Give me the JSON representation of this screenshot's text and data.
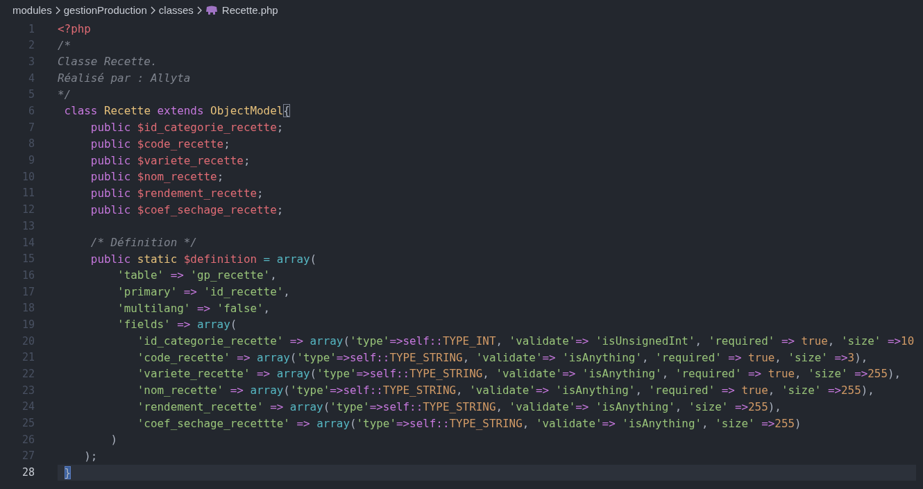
{
  "breadcrumb": [
    {
      "label": "modules",
      "kind": "folder"
    },
    {
      "label": "gestionProduction",
      "kind": "folder"
    },
    {
      "label": "classes",
      "kind": "folder"
    },
    {
      "label": "Recette.php",
      "kind": "php_file"
    }
  ],
  "lines": [
    {
      "number": "1",
      "current": false,
      "tokens": [
        {
          "text": "<?php",
          "kind": "tag"
        }
      ]
    },
    {
      "number": "2",
      "current": false,
      "tokens": [
        {
          "text": "/*",
          "kind": "comment"
        }
      ]
    },
    {
      "number": "3",
      "current": false,
      "tokens": [
        {
          "text": "Classe Recette.",
          "kind": "comment"
        }
      ]
    },
    {
      "number": "4",
      "current": false,
      "tokens": [
        {
          "text": "Réalisé par : Allyta",
          "kind": "comment"
        }
      ]
    },
    {
      "number": "5",
      "current": false,
      "tokens": [
        {
          "text": "*/",
          "kind": "comment"
        }
      ]
    },
    {
      "number": "6",
      "current": false,
      "tokens": [
        {
          "text": " class",
          "kind": "keyword"
        },
        {
          "text": " Recette",
          "kind": "class"
        },
        {
          "text": " extends",
          "kind": "keyword"
        },
        {
          "text": " ObjectModel",
          "kind": "class"
        },
        {
          "text": "{",
          "kind": "bracket_match"
        }
      ]
    },
    {
      "number": "7",
      "current": false,
      "tokens": [
        {
          "text": "     public",
          "kind": "keyword"
        },
        {
          "text": " $id_categorie_recette",
          "kind": "variable"
        },
        {
          "text": ";",
          "kind": "plain"
        }
      ]
    },
    {
      "number": "8",
      "current": false,
      "tokens": [
        {
          "text": "     public",
          "kind": "keyword"
        },
        {
          "text": " $code_recette",
          "kind": "variable"
        },
        {
          "text": ";",
          "kind": "plain"
        }
      ]
    },
    {
      "number": "9",
      "current": false,
      "tokens": [
        {
          "text": "     public",
          "kind": "keyword"
        },
        {
          "text": " $variete_recette",
          "kind": "variable"
        },
        {
          "text": ";",
          "kind": "plain"
        }
      ]
    },
    {
      "number": "10",
      "current": false,
      "tokens": [
        {
          "text": "     public",
          "kind": "keyword"
        },
        {
          "text": " $nom_recette",
          "kind": "variable"
        },
        {
          "text": ";",
          "kind": "plain"
        }
      ]
    },
    {
      "number": "11",
      "current": false,
      "tokens": [
        {
          "text": "     public",
          "kind": "keyword"
        },
        {
          "text": " $rendement_recette",
          "kind": "variable"
        },
        {
          "text": ";",
          "kind": "plain"
        }
      ]
    },
    {
      "number": "12",
      "current": false,
      "tokens": [
        {
          "text": "     public",
          "kind": "keyword"
        },
        {
          "text": " $coef_sechage_recette",
          "kind": "variable"
        },
        {
          "text": ";",
          "kind": "plain"
        }
      ]
    },
    {
      "number": "13",
      "current": false
    },
    {
      "number": "14",
      "current": false,
      "tokens": [
        {
          "text": "     /* Définition */",
          "kind": "comment"
        }
      ]
    },
    {
      "number": "15",
      "current": false,
      "tokens": [
        {
          "text": "     public",
          "kind": "keyword"
        },
        {
          "text": " static",
          "kind": "class"
        },
        {
          "text": " $definition",
          "kind": "variable"
        },
        {
          "text": " =",
          "kind": "function"
        },
        {
          "text": " array",
          "kind": "function"
        },
        {
          "text": "(",
          "kind": "plain"
        }
      ]
    },
    {
      "number": "16",
      "current": false,
      "tokens": [
        {
          "text": "         'table'",
          "kind": "string"
        },
        {
          "text": " =>",
          "kind": "operator"
        },
        {
          "text": " 'gp_recette'",
          "kind": "string"
        },
        {
          "text": ",",
          "kind": "plain"
        }
      ]
    },
    {
      "number": "17",
      "current": false,
      "tokens": [
        {
          "text": "         'primary'",
          "kind": "string"
        },
        {
          "text": " =>",
          "kind": "operator"
        },
        {
          "text": " 'id_recette'",
          "kind": "string"
        },
        {
          "text": ",",
          "kind": "plain"
        }
      ]
    },
    {
      "number": "18",
      "current": false,
      "tokens": [
        {
          "text": "         'multilang'",
          "kind": "string"
        },
        {
          "text": " =>",
          "kind": "operator"
        },
        {
          "text": " 'false'",
          "kind": "string"
        },
        {
          "text": ",",
          "kind": "plain"
        }
      ]
    },
    {
      "number": "19",
      "current": false,
      "tokens": [
        {
          "text": "         'fields'",
          "kind": "string"
        },
        {
          "text": " =>",
          "kind": "operator"
        },
        {
          "text": " array",
          "kind": "function"
        },
        {
          "text": "(",
          "kind": "plain"
        }
      ]
    },
    {
      "number": "20",
      "current": false,
      "tokens": [
        {
          "text": "            'id_categorie_recette'",
          "kind": "string"
        },
        {
          "text": " =>",
          "kind": "operator"
        },
        {
          "text": " array",
          "kind": "function"
        },
        {
          "text": "(",
          "kind": "plain"
        },
        {
          "text": "'type'",
          "kind": "string"
        },
        {
          "text": "=>",
          "kind": "operator"
        },
        {
          "text": "self::",
          "kind": "keyword"
        },
        {
          "text": "TYPE_INT",
          "kind": "constant"
        },
        {
          "text": ", ",
          "kind": "plain"
        },
        {
          "text": "'validate'",
          "kind": "string"
        },
        {
          "text": "=>",
          "kind": "operator"
        },
        {
          "text": " 'isUnsignedInt'",
          "kind": "string"
        },
        {
          "text": ", ",
          "kind": "plain"
        },
        {
          "text": "'required'",
          "kind": "string"
        },
        {
          "text": " =>",
          "kind": "operator"
        },
        {
          "text": " true",
          "kind": "constant"
        },
        {
          "text": ", ",
          "kind": "plain"
        },
        {
          "text": "'size'",
          "kind": "string"
        },
        {
          "text": " =>",
          "kind": "operator"
        },
        {
          "text": "10",
          "kind": "constant"
        }
      ]
    },
    {
      "number": "21",
      "current": false,
      "tokens": [
        {
          "text": "            'code_recette'",
          "kind": "string"
        },
        {
          "text": " =>",
          "kind": "operator"
        },
        {
          "text": " array",
          "kind": "function"
        },
        {
          "text": "(",
          "kind": "plain"
        },
        {
          "text": "'type'",
          "kind": "string"
        },
        {
          "text": "=>",
          "kind": "operator"
        },
        {
          "text": "self::",
          "kind": "keyword"
        },
        {
          "text": "TYPE_STRING",
          "kind": "constant"
        },
        {
          "text": ", ",
          "kind": "plain"
        },
        {
          "text": "'validate'",
          "kind": "string"
        },
        {
          "text": "=>",
          "kind": "operator"
        },
        {
          "text": " 'isAnything'",
          "kind": "string"
        },
        {
          "text": ", ",
          "kind": "plain"
        },
        {
          "text": "'required'",
          "kind": "string"
        },
        {
          "text": " =>",
          "kind": "operator"
        },
        {
          "text": " true",
          "kind": "constant"
        },
        {
          "text": ", ",
          "kind": "plain"
        },
        {
          "text": "'size'",
          "kind": "string"
        },
        {
          "text": " =>",
          "kind": "operator"
        },
        {
          "text": "3",
          "kind": "constant"
        },
        {
          "text": "),",
          "kind": "plain"
        }
      ]
    },
    {
      "number": "22",
      "current": false,
      "tokens": [
        {
          "text": "            'variete_recette'",
          "kind": "string"
        },
        {
          "text": " =>",
          "kind": "operator"
        },
        {
          "text": " array",
          "kind": "function"
        },
        {
          "text": "(",
          "kind": "plain"
        },
        {
          "text": "'type'",
          "kind": "string"
        },
        {
          "text": "=>",
          "kind": "operator"
        },
        {
          "text": "self::",
          "kind": "keyword"
        },
        {
          "text": "TYPE_STRING",
          "kind": "constant"
        },
        {
          "text": ", ",
          "kind": "plain"
        },
        {
          "text": "'validate'",
          "kind": "string"
        },
        {
          "text": "=>",
          "kind": "operator"
        },
        {
          "text": " 'isAnything'",
          "kind": "string"
        },
        {
          "text": ", ",
          "kind": "plain"
        },
        {
          "text": "'required'",
          "kind": "string"
        },
        {
          "text": " =>",
          "kind": "operator"
        },
        {
          "text": " true",
          "kind": "constant"
        },
        {
          "text": ", ",
          "kind": "plain"
        },
        {
          "text": "'size'",
          "kind": "string"
        },
        {
          "text": " =>",
          "kind": "operator"
        },
        {
          "text": "255",
          "kind": "constant"
        },
        {
          "text": "),",
          "kind": "plain"
        }
      ]
    },
    {
      "number": "23",
      "current": false,
      "tokens": [
        {
          "text": "            'nom_recette'",
          "kind": "string"
        },
        {
          "text": " =>",
          "kind": "operator"
        },
        {
          "text": " array",
          "kind": "function"
        },
        {
          "text": "(",
          "kind": "plain"
        },
        {
          "text": "'type'",
          "kind": "string"
        },
        {
          "text": "=>",
          "kind": "operator"
        },
        {
          "text": "self::",
          "kind": "keyword"
        },
        {
          "text": "TYPE_STRING",
          "kind": "constant"
        },
        {
          "text": ", ",
          "kind": "plain"
        },
        {
          "text": "'validate'",
          "kind": "string"
        },
        {
          "text": "=>",
          "kind": "operator"
        },
        {
          "text": " 'isAnything'",
          "kind": "string"
        },
        {
          "text": ", ",
          "kind": "plain"
        },
        {
          "text": "'required'",
          "kind": "string"
        },
        {
          "text": " =>",
          "kind": "operator"
        },
        {
          "text": " true",
          "kind": "constant"
        },
        {
          "text": ", ",
          "kind": "plain"
        },
        {
          "text": "'size'",
          "kind": "string"
        },
        {
          "text": " =>",
          "kind": "operator"
        },
        {
          "text": "255",
          "kind": "constant"
        },
        {
          "text": "),",
          "kind": "plain"
        }
      ]
    },
    {
      "number": "24",
      "current": false,
      "tokens": [
        {
          "text": "            'rendement_recette'",
          "kind": "string"
        },
        {
          "text": " =>",
          "kind": "operator"
        },
        {
          "text": " array",
          "kind": "function"
        },
        {
          "text": "(",
          "kind": "plain"
        },
        {
          "text": "'type'",
          "kind": "string"
        },
        {
          "text": "=>",
          "kind": "operator"
        },
        {
          "text": "self::",
          "kind": "keyword"
        },
        {
          "text": "TYPE_STRING",
          "kind": "constant"
        },
        {
          "text": ", ",
          "kind": "plain"
        },
        {
          "text": "'validate'",
          "kind": "string"
        },
        {
          "text": "=>",
          "kind": "operator"
        },
        {
          "text": " 'isAnything'",
          "kind": "string"
        },
        {
          "text": ", ",
          "kind": "plain"
        },
        {
          "text": "'size'",
          "kind": "string"
        },
        {
          "text": " =>",
          "kind": "operator"
        },
        {
          "text": "255",
          "kind": "constant"
        },
        {
          "text": "),",
          "kind": "plain"
        }
      ]
    },
    {
      "number": "25",
      "current": false,
      "tokens": [
        {
          "text": "            'coef_sechage_recettte'",
          "kind": "string"
        },
        {
          "text": " =>",
          "kind": "operator"
        },
        {
          "text": " array",
          "kind": "function"
        },
        {
          "text": "(",
          "kind": "plain"
        },
        {
          "text": "'type'",
          "kind": "string"
        },
        {
          "text": "=>",
          "kind": "operator"
        },
        {
          "text": "self::",
          "kind": "keyword"
        },
        {
          "text": "TYPE_STRING",
          "kind": "constant"
        },
        {
          "text": ", ",
          "kind": "plain"
        },
        {
          "text": "'validate'",
          "kind": "string"
        },
        {
          "text": "=>",
          "kind": "operator"
        },
        {
          "text": " 'isAnything'",
          "kind": "string"
        },
        {
          "text": ", ",
          "kind": "plain"
        },
        {
          "text": "'size'",
          "kind": "string"
        },
        {
          "text": " =>",
          "kind": "operator"
        },
        {
          "text": "255",
          "kind": "constant"
        },
        {
          "text": ")",
          "kind": "plain"
        }
      ]
    },
    {
      "number": "26",
      "current": false,
      "tokens": [
        {
          "text": "        )",
          "kind": "plain"
        }
      ]
    },
    {
      "number": "27",
      "current": false,
      "tokens": [
        {
          "text": "    );",
          "kind": "plain"
        }
      ]
    },
    {
      "number": "28",
      "current": true,
      "tokens": [
        {
          "text": " }",
          "kind": "bracket_match"
        }
      ]
    }
  ]
}
